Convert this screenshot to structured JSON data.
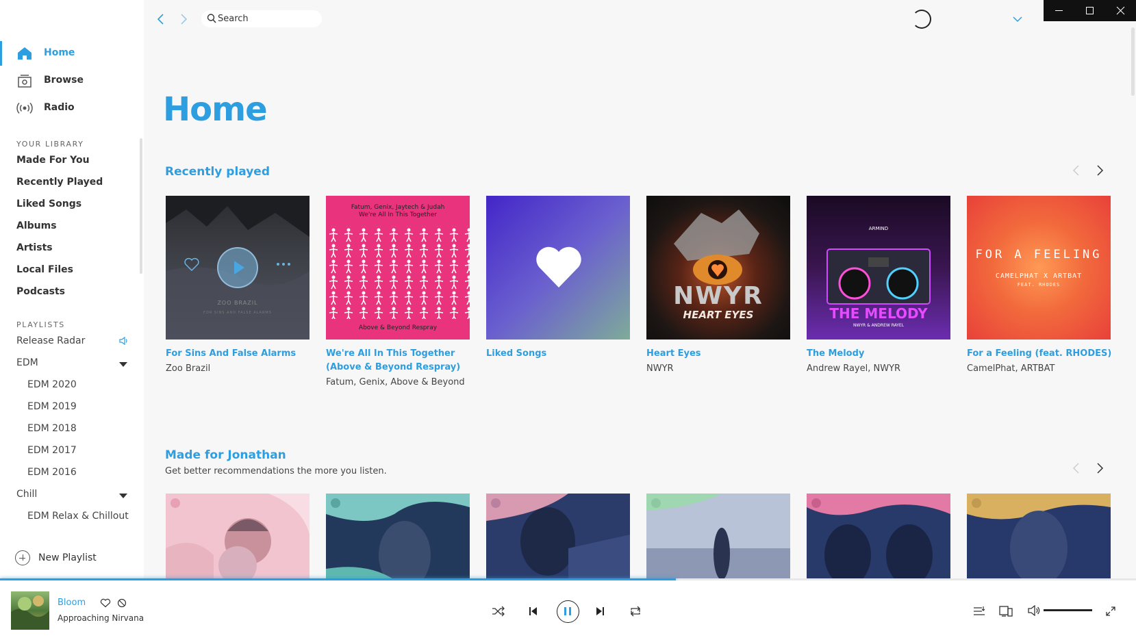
{
  "sidebar": {
    "nav": [
      {
        "label": "Home",
        "icon": "home-icon"
      },
      {
        "label": "Browse",
        "icon": "browse-icon"
      },
      {
        "label": "Radio",
        "icon": "radio-icon"
      }
    ],
    "library_title": "YOUR LIBRARY",
    "library_items": [
      "Made For You",
      "Recently Played",
      "Liked Songs",
      "Albums",
      "Artists",
      "Local Files",
      "Podcasts"
    ],
    "playlists_title": "PLAYLISTS",
    "playlists": [
      {
        "label": "Release Radar",
        "icon": "speaker-icon"
      },
      {
        "label": "EDM",
        "folder": true
      },
      {
        "label": "EDM 2020"
      },
      {
        "label": "EDM 2019"
      },
      {
        "label": "EDM 2018"
      },
      {
        "label": "EDM 2017"
      },
      {
        "label": "EDM 2016"
      },
      {
        "label": "Chill",
        "folder": true
      },
      {
        "label": "EDM Relax & Chillout"
      }
    ],
    "new_playlist_label": "New Playlist"
  },
  "topbar": {
    "search_placeholder": "Search"
  },
  "main": {
    "page_title": "Home",
    "recently_played": {
      "title": "Recently played",
      "cards": [
        {
          "title": "For Sins And False Alarms",
          "subtitle": "Zoo Brazil",
          "art_text": [
            "ZOO BRAZIL",
            "FOR SINS AND FALSE ALARMS"
          ]
        },
        {
          "title": "We're All In This Together (Above & Beyond Respray)",
          "subtitle": "Fatum, Genix, Above & Beyond",
          "art_text": [
            "Fatum, Genix, Jaytech & Judah",
            "We're All In This Together",
            "Above & Beyond Respray"
          ]
        },
        {
          "title": "Liked Songs",
          "subtitle": ""
        },
        {
          "title": "Heart Eyes",
          "subtitle": "NWYR",
          "art_text": [
            "NWYR",
            "HEART EYES"
          ]
        },
        {
          "title": "The Melody",
          "subtitle": "Andrew Rayel, NWYR",
          "art_text": [
            "ARMIND",
            "THE MELODY",
            "NWYR & ANDREW RAYEL"
          ]
        },
        {
          "title": "For a Feeling (feat. RHODES)",
          "subtitle": "CamelPhat, ARTBAT",
          "art_text": [
            "FOR A FEELING",
            "CAMELPHAT X ARTBAT",
            "FEAT. RHODES"
          ]
        }
      ]
    },
    "made_for": {
      "title": "Made for Jonathan",
      "subtitle": "Get better recommendations the more you listen."
    }
  },
  "player": {
    "track_title": "Bloom",
    "track_artist": "Approaching Nirvana",
    "progress": 0.595,
    "volume": 1.0,
    "colors": {
      "accent": "#2d9ee0"
    }
  }
}
